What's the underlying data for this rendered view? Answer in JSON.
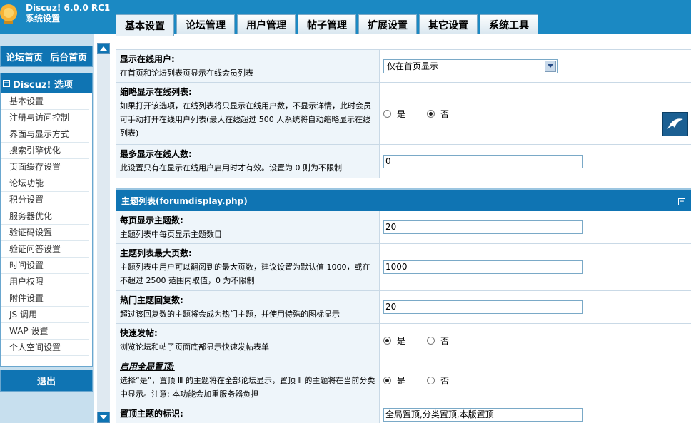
{
  "app": {
    "brand_line1": "Discuz! 6.0.0 RC1",
    "brand_line2": "系统设置"
  },
  "tabs": [
    {
      "label": "基本设置",
      "active": true
    },
    {
      "label": "论坛管理",
      "active": false
    },
    {
      "label": "用户管理",
      "active": false
    },
    {
      "label": "帖子管理",
      "active": false
    },
    {
      "label": "扩展设置",
      "active": false
    },
    {
      "label": "其它设置",
      "active": false
    },
    {
      "label": "系统工具",
      "active": false
    }
  ],
  "sidebar": {
    "forum_home": "论坛首页",
    "admin_home": "后台首页",
    "menu_title": "Discuz! 选项",
    "items": [
      "基本设置",
      "注册与访问控制",
      "界面与显示方式",
      "搜索引擎优化",
      "页面缓存设置",
      "论坛功能",
      "积分设置",
      "服务器优化",
      "验证码设置",
      "验证问答设置",
      "时间设置",
      "用户权限",
      "附件设置",
      "JS 调用",
      "WAP 设置",
      "个人空间设置"
    ],
    "logout": "退出"
  },
  "section1": {
    "rows": [
      {
        "title": "显示在线用户:",
        "desc": "在首页和论坛列表页显示在线会员列表",
        "select_value": "仅在首页显示"
      },
      {
        "title": "缩略显示在线列表:",
        "desc": "如果打开该选项，在线列表将只显示在线用户数，不显示详情，此时会员可手动打开在线用户列表(最大在线超过  500 人系统将自动缩略显示在线列表)",
        "yes": "是",
        "no": "否"
      },
      {
        "title": "最多显示在线人数:",
        "desc": "此设置只有在显示在线用户启用时才有效。设置为  0 则为不限制",
        "value": "0"
      }
    ]
  },
  "section2": {
    "title": "主题列表(forumdisplay.php)",
    "rows": [
      {
        "title": "每页显示主题数:",
        "desc": "主题列表中每页显示主题数目",
        "value": "20"
      },
      {
        "title": "主题列表最大页数:",
        "desc": "主题列表中用户可以翻阅到的最大页数，建议设置为默认值  1000，或在不超过  2500 范围内取值，0 为不限制",
        "value": "1000"
      },
      {
        "title": "热门主题回复数:",
        "desc": "超过该回复数的主题将会成为热门主题，并使用特殊的图标显示",
        "value": "20"
      },
      {
        "title": "快速发帖:",
        "desc": "浏览论坛和帖子页面底部显示快速发帖表单",
        "yes": "是",
        "no": "否"
      },
      {
        "title": "启用全局置顶:",
        "desc": "选择“是”，置顶 Ⅲ 的主题将在全部论坛显示，置顶 Ⅱ 的主题将在当前分类中显示。注意: 本功能会加重服务器负担",
        "yes": "是",
        "no": "否"
      },
      {
        "title": "置顶主题的标识:",
        "value": "全局置顶,分类置顶,本版置顶"
      }
    ]
  },
  "colors": {
    "header_blue": "#1b89c3",
    "nav_blue": "#0f74b3",
    "row_bg": "#eef5fa",
    "sidebar_bg": "#c7dfee"
  },
  "icons": [
    "logo-bulb-icon",
    "collapse-minus-icon",
    "scroll-up-icon",
    "scroll-down-icon",
    "dropdown-arrow-icon",
    "float-bird-icon"
  ]
}
